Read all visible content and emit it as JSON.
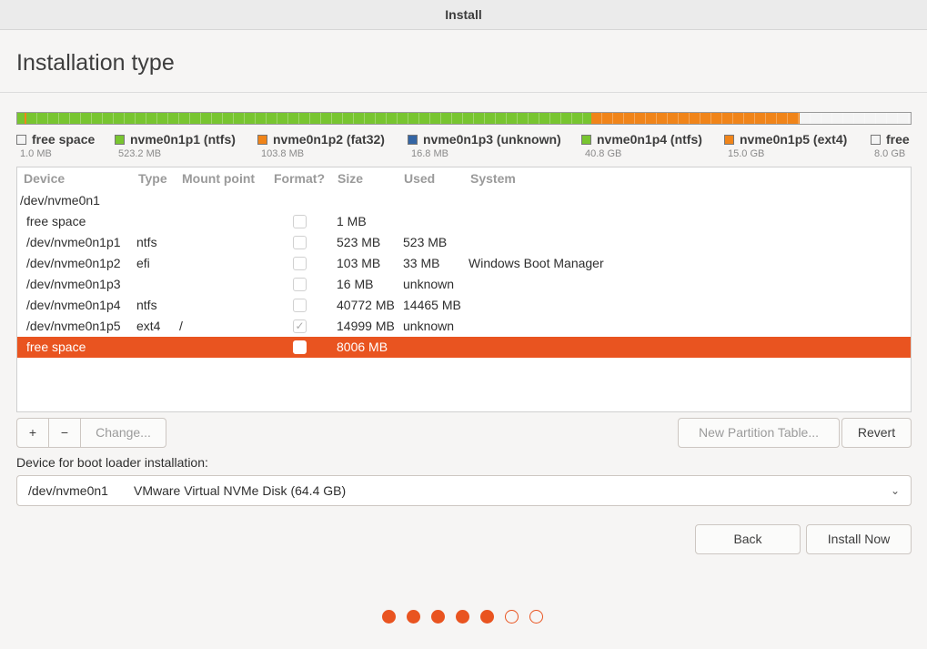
{
  "window": {
    "title": "Install"
  },
  "page": {
    "heading": "Installation type"
  },
  "partition_bar": [
    {
      "label": "free space",
      "size": "1.0 MB",
      "mb": 1,
      "color": "#f4f4f4"
    },
    {
      "label": "nvme0n1p1 (ntfs)",
      "size": "523.2 MB",
      "mb": 523,
      "color": "#78c530"
    },
    {
      "label": "nvme0n1p2 (fat32)",
      "size": "103.8 MB",
      "mb": 103,
      "color": "#f08419"
    },
    {
      "label": "nvme0n1p3 (unknown)",
      "size": "16.8 MB",
      "mb": 16,
      "color": "#3465a4"
    },
    {
      "label": "nvme0n1p4 (ntfs)",
      "size": "40.8 GB",
      "mb": 40772,
      "color": "#78c530"
    },
    {
      "label": "nvme0n1p5 (ext4)",
      "size": "15.0 GB",
      "mb": 14999,
      "color": "#f08419"
    },
    {
      "label": "free space",
      "size": "8.0 GB",
      "mb": 8006,
      "color": "#f4f4f4"
    }
  ],
  "table": {
    "headers": [
      "Device",
      "Type",
      "Mount point",
      "Format?",
      "Size",
      "Used",
      "System"
    ],
    "disk": "/dev/nvme0n1",
    "rows": [
      {
        "device": "free space",
        "type": "",
        "mount": "",
        "format": false,
        "size": "1 MB",
        "used": "",
        "system": ""
      },
      {
        "device": "/dev/nvme0n1p1",
        "type": "ntfs",
        "mount": "",
        "format": false,
        "size": "523 MB",
        "used": "523 MB",
        "system": ""
      },
      {
        "device": "/dev/nvme0n1p2",
        "type": "efi",
        "mount": "",
        "format": false,
        "size": "103 MB",
        "used": "33 MB",
        "system": "Windows Boot Manager"
      },
      {
        "device": "/dev/nvme0n1p3",
        "type": "",
        "mount": "",
        "format": false,
        "size": "16 MB",
        "used": "unknown",
        "system": ""
      },
      {
        "device": "/dev/nvme0n1p4",
        "type": "ntfs",
        "mount": "",
        "format": false,
        "size": "40772 MB",
        "used": "14465 MB",
        "system": ""
      },
      {
        "device": "/dev/nvme0n1p5",
        "type": "ext4",
        "mount": "/",
        "format": true,
        "size": "14999 MB",
        "used": "unknown",
        "system": ""
      },
      {
        "device": "free space",
        "type": "",
        "mount": "",
        "format": false,
        "size": "8006 MB",
        "used": "",
        "system": "",
        "selected": true
      }
    ]
  },
  "buttons": {
    "add": "+",
    "remove": "−",
    "change": "Change...",
    "new_table": "New Partition Table...",
    "revert": "Revert",
    "back": "Back",
    "install": "Install Now"
  },
  "bootloader": {
    "label": "Device for boot loader installation:",
    "device": "/dev/nvme0n1",
    "description": "VMware Virtual NVMe Disk (64.4 GB)"
  },
  "progress": {
    "total_steps": 7,
    "completed_steps": 5
  },
  "colors": {
    "accent": "#e95420"
  }
}
